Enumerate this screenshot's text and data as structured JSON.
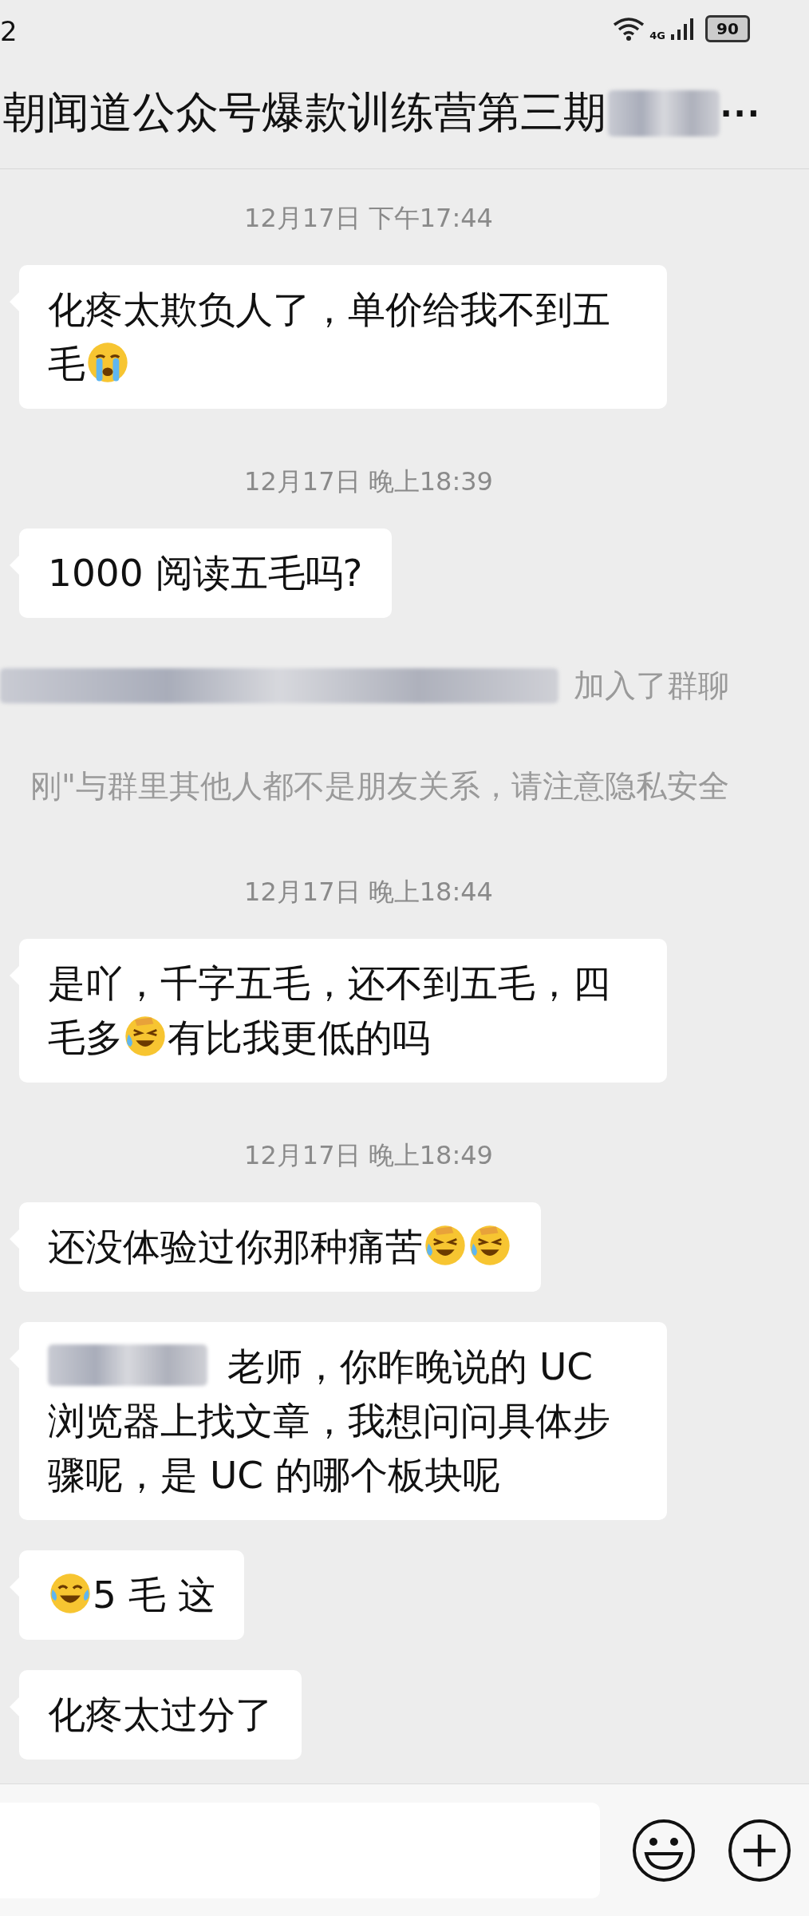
{
  "status_bar": {
    "time": "2",
    "network": "4G",
    "battery": "90"
  },
  "title_bar": {
    "title": "朝闻道公众号爆款训练营第三期",
    "title_redacted": true,
    "more": "···"
  },
  "messages": [
    {
      "kind": "time",
      "text": "12月17日 下午17:44"
    },
    {
      "kind": "bubble",
      "parts": [
        {
          "kind": "text",
          "text": "化疼太欺负人了，单价给我不到五毛"
        },
        {
          "kind": "sob"
        }
      ]
    },
    {
      "kind": "time",
      "text": "12月17日 晚上18:39"
    },
    {
      "kind": "bubble",
      "parts": [
        {
          "kind": "text",
          "text": "1000 阅读五毛吗?"
        }
      ]
    },
    {
      "kind": "system",
      "redacted": true,
      "text": "加入了群聊"
    },
    {
      "kind": "system",
      "redacted": false,
      "text": "刚\"与群里其他人都不是朋友关系，请注意隐私安全"
    },
    {
      "kind": "time",
      "text": "12月17日 晚上18:44"
    },
    {
      "kind": "bubble",
      "parts": [
        {
          "kind": "text",
          "text": "是吖，千字五毛，还不到五毛，四毛多"
        },
        {
          "kind": "laughcry"
        },
        {
          "kind": "text",
          "text": "有比我更低的吗"
        }
      ]
    },
    {
      "kind": "time",
      "text": "12月17日 晚上18:49"
    },
    {
      "kind": "bubble",
      "parts": [
        {
          "kind": "text",
          "text": "还没体验过你那种痛苦"
        },
        {
          "kind": "laughcry"
        },
        {
          "kind": "laughcry"
        }
      ]
    },
    {
      "kind": "bubble",
      "parts": [
        {
          "kind": "blurred"
        },
        {
          "kind": "text",
          "text": " 老师，你昨晚说的 UC 浏览器上找文章，我想问问具体步骤呢，是 UC 的哪个板块呢"
        }
      ]
    },
    {
      "kind": "bubble",
      "parts": [
        {
          "kind": "joy"
        },
        {
          "kind": "text",
          "text": "5 毛 这"
        }
      ]
    },
    {
      "kind": "bubble",
      "parts": [
        {
          "kind": "text",
          "text": "化疼太过分了"
        }
      ]
    }
  ]
}
